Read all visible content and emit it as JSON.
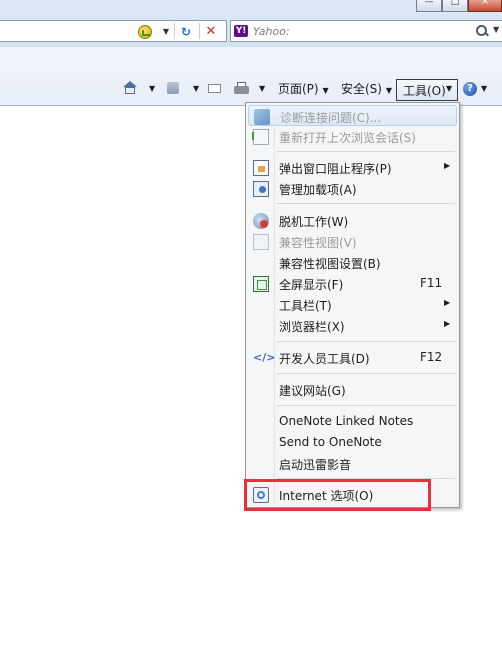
{
  "window": {
    "controls": {
      "minimize": "—",
      "maximize": "□",
      "close": "✕"
    }
  },
  "address_bar": {
    "icons": [
      "compatibility-icon",
      "dropdown-icon",
      "refresh-icon",
      "stop-icon"
    ],
    "dropdown_glyph": "▼",
    "refresh_glyph": "⁴↯",
    "stop_glyph": "✕"
  },
  "search": {
    "placeholder": "Yahoo:",
    "logo_text": "Y!",
    "dropdown_glyph": "▼"
  },
  "command_bar": {
    "page_label": "页面(P)",
    "safety_label": "安全(S)",
    "tools_label": "工具(O)",
    "help_glyph": "?",
    "arrow": "▼"
  },
  "tools_menu": {
    "items": [
      {
        "label": "诊断连接问题(C)...",
        "disabled": true,
        "icon": "diagnose-icon"
      },
      {
        "label": "重新打开上次浏览会话(S)",
        "disabled": true,
        "icon": "reopen-session-icon"
      },
      {
        "label": "弹出窗口阻止程序(P)",
        "submenu": true,
        "icon": "popup-blocker-icon"
      },
      {
        "label": "管理加载项(A)",
        "icon": "add-ons-icon"
      },
      {
        "label": "脱机工作(W)",
        "icon": "work-offline-icon"
      },
      {
        "label": "兼容性视图(V)",
        "disabled": true,
        "icon": "compat-view-icon"
      },
      {
        "label": "兼容性视图设置(B)"
      },
      {
        "label": "全屏显示(F)",
        "shortcut": "F11",
        "icon": "fullscreen-icon"
      },
      {
        "label": "工具栏(T)",
        "submenu": true
      },
      {
        "label": "浏览器栏(X)",
        "submenu": true
      },
      {
        "label": "开发人员工具(D)",
        "shortcut": "F12",
        "icon": "developer-tools-icon"
      },
      {
        "label": "建议网站(G)"
      },
      {
        "label": "OneNote Linked Notes"
      },
      {
        "label": "Send to OneNote"
      },
      {
        "label": "启动迅雷影音"
      },
      {
        "label": "Internet 选项(O)",
        "icon": "internet-options-icon"
      }
    ],
    "submenu_glyph": "▶"
  },
  "highlight_color": "#e8323a"
}
